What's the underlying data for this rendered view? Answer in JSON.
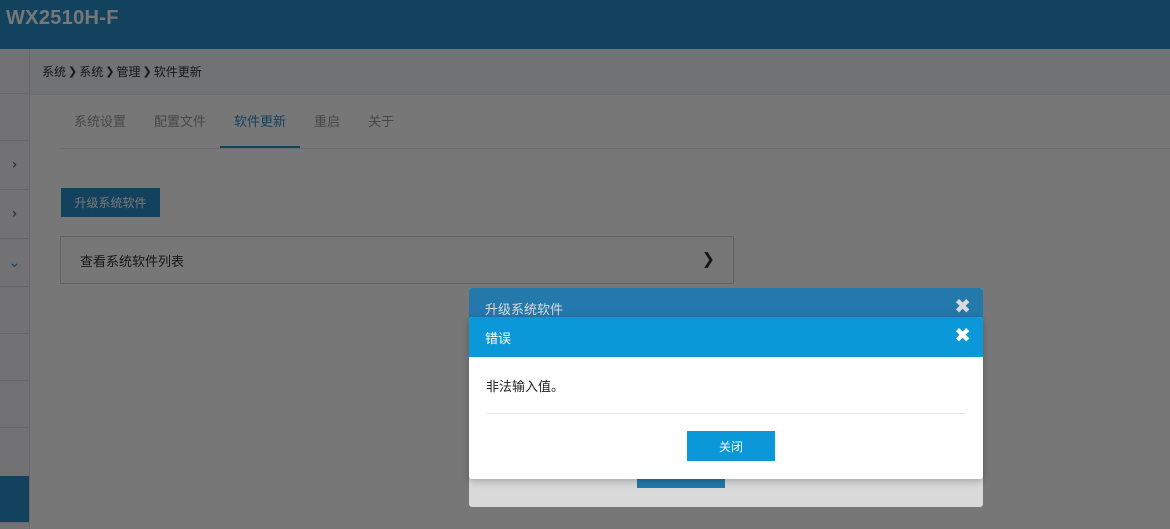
{
  "header": {
    "title": "WX2510H-F"
  },
  "breadcrumb": [
    "系统",
    "系统",
    "管理",
    "软件更新"
  ],
  "tabs": [
    {
      "label": "系统设置",
      "active": false
    },
    {
      "label": "配置文件",
      "active": false
    },
    {
      "label": "软件更新",
      "active": true
    },
    {
      "label": "重启",
      "active": false
    },
    {
      "label": "关于",
      "active": false
    }
  ],
  "main": {
    "upgrade_button": "升级系统软件",
    "list_row_label": "查看系统软件列表"
  },
  "dialog_back": {
    "title": "升级系统软件"
  },
  "dialog_error": {
    "title": "错误",
    "message": "非法输入值。",
    "close_button": "关闭"
  },
  "colors": {
    "brand": "#2a8fcb",
    "dialog_header": "#0a98d8"
  }
}
